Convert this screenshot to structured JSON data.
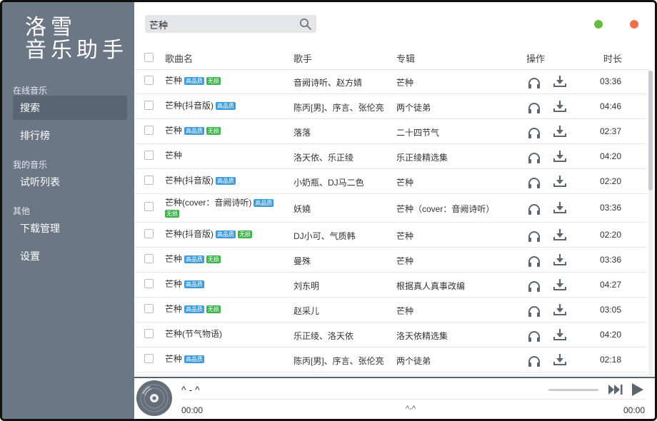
{
  "app": {
    "logo_line1": "洛雪",
    "logo_line2": "音乐助手"
  },
  "sidebar": {
    "groups": [
      {
        "label": "在线音乐"
      },
      {
        "label": "我的音乐"
      },
      {
        "label": "其他"
      }
    ],
    "items": [
      {
        "label": "搜索",
        "active": true
      },
      {
        "label": "排行榜"
      },
      {
        "label": "试听列表"
      },
      {
        "label": "下载管理"
      },
      {
        "label": "设置"
      }
    ]
  },
  "search": {
    "value": "芒种",
    "icon": "search-icon"
  },
  "window_controls": {
    "minimize_color": "#65bd3c",
    "close_color": "#ef6f4c"
  },
  "table": {
    "headers": {
      "title": "歌曲名",
      "artist": "歌手",
      "album": "专辑",
      "ops": "操作",
      "duration": "时长"
    },
    "tag_labels": {
      "hq": "高品质",
      "lossless": "无损"
    },
    "rows": [
      {
        "title": "芒种",
        "hq": true,
        "lossless": true,
        "artist": "音阙诗听、赵方婧",
        "album": "芒种",
        "duration": "03:36"
      },
      {
        "title": "芒种(抖音版)",
        "hq": true,
        "lossless": false,
        "artist": "陈丙[男]、序言、张伦亮",
        "album": "两个徒弟",
        "duration": "04:46"
      },
      {
        "title": "芒种",
        "hq": true,
        "lossless": true,
        "artist": "落落",
        "album": "二十四节气",
        "duration": "02:37"
      },
      {
        "title": "芒种",
        "hq": false,
        "lossless": false,
        "artist": "洛天依、乐正绫",
        "album": "乐正绫精选集",
        "duration": "04:20"
      },
      {
        "title": "芒种(抖音版)",
        "hq": true,
        "lossless": false,
        "artist": "小奶瓶、DJ马二色",
        "album": "芒种",
        "duration": "02:20"
      },
      {
        "title": "芒种(cover：音阙诗听)",
        "hq": true,
        "lossless": true,
        "artist": "妖嬈",
        "album": "芒种（cover：音阙诗听）",
        "duration": "03:36",
        "tall": true
      },
      {
        "title": "芒种(抖音版)",
        "hq": true,
        "lossless": true,
        "artist": "DJ小可、气质韩",
        "album": "芒种",
        "duration": "02:20"
      },
      {
        "title": "芒种",
        "hq": true,
        "lossless": true,
        "artist": "曼殊",
        "album": "芒种",
        "duration": "03:36"
      },
      {
        "title": "芒种",
        "hq": true,
        "lossless": false,
        "artist": "刘东明",
        "album": "根据真人真事改编",
        "duration": "04:27"
      },
      {
        "title": "芒种",
        "hq": true,
        "lossless": true,
        "artist": "赵采儿",
        "album": "芒种",
        "duration": "03:05"
      },
      {
        "title": "芒种(节气物语)",
        "hq": false,
        "lossless": false,
        "artist": "乐正绫、洛天依",
        "album": "洛天依精选集",
        "duration": "04:20"
      },
      {
        "title": "芒种",
        "hq": true,
        "lossless": false,
        "artist": "陈丙[男]、序言、张伦亮",
        "album": "两个徒弟",
        "duration": "02:18"
      }
    ]
  },
  "player": {
    "title": "^ - ^",
    "artist": "^-^",
    "current_time": "00:00",
    "total_time": "00:00"
  }
}
